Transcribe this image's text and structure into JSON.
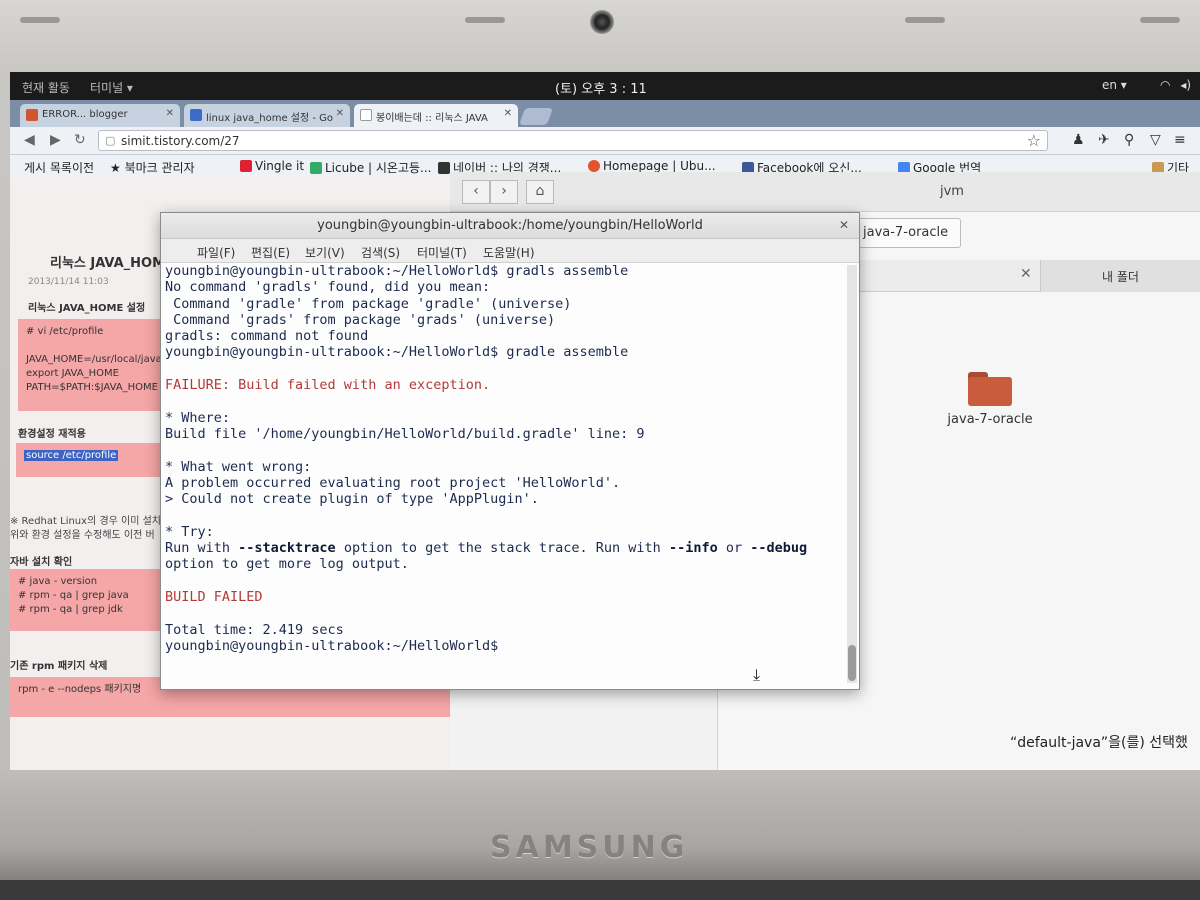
{
  "topbar": {
    "activities": "현재 활동",
    "app_menu": "터미널 ▾",
    "clock": "(토) 오후 3 : 11",
    "lang": "en ▾"
  },
  "browser": {
    "tabs": [
      {
        "label": "ERROR... blogger"
      },
      {
        "label": "linux java_home 설정 - Go"
      },
      {
        "label": "봉이배는데 :: 리눅스 JAVA"
      }
    ],
    "url": "simit.tistory.com/27",
    "bookmarks": [
      {
        "label": "게시 목록이전"
      },
      {
        "label": "북마크 관리자"
      },
      {
        "label": "Vingle it"
      },
      {
        "label": "Licube | 시온고등..."
      },
      {
        "label": "네이버 :: 나의 경쟁..."
      },
      {
        "label": "Homepage | Ubu..."
      },
      {
        "label": "Facebook에 오신..."
      },
      {
        "label": "Google 번역"
      },
      {
        "label": "기타"
      }
    ]
  },
  "blog": {
    "title": "리눅스 JAVA_HOME 설",
    "meta": "2013/11/14 11:03",
    "section1": "리눅스 JAVA_HOME 설정",
    "box1_lines": [
      "# vi /etc/profile",
      "",
      "JAVA_HOME=/usr/local/java",
      "export JAVA_HOME",
      "PATH=$PATH:$JAVA_HOME"
    ],
    "section2": "환경설정 재적용",
    "box2_line": "source /etc/profile",
    "note_line1": "※ Redhat Linux의 경우 이미 설치",
    "note_line2": "위와 환경 설정을 수정해도 이전 버",
    "section3": "자바 설치 확인",
    "box3_lines": [
      "# java - version",
      "# rpm - qa | grep java",
      "# rpm - qa | grep jdk"
    ],
    "section4": "기존 rpm 패키지 삭제",
    "box4_line": "rpm - e --nodeps 패키지명"
  },
  "file_manager": {
    "title": "jvm",
    "path_button": "java-7-oracle",
    "tab2_label": "내 폴더",
    "folder_label": "java-7-oracle",
    "status": "“default-java”을(를) 선택했"
  },
  "terminal": {
    "title": "youngbin@youngbin-ultrabook:/home/youngbin/HelloWorld",
    "menu": [
      "파일(F)",
      "편집(E)",
      "보기(V)",
      "검색(S)",
      "터미널(T)",
      "도움말(H)"
    ],
    "lines": [
      "youngbin@youngbin-ultrabook:~/HelloWorld$ gradls assemble",
      "No command 'gradls' found, did you mean:",
      " Command 'gradle' from package 'gradle' (universe)",
      " Command 'grads' from package 'grads' (universe)",
      "gradls: command not found",
      "youngbin@youngbin-ultrabook:~/HelloWorld$ gradle assemble",
      "",
      "FAILURE: Build failed with an exception.",
      "",
      "* Where:",
      "Build file '/home/youngbin/HelloWorld/build.gradle' line: 9",
      "",
      "* What went wrong:",
      "A problem occurred evaluating root project 'HelloWorld'.",
      "> Could not create plugin of type 'AppPlugin'.",
      "",
      "* Try:",
      "Run with --stacktrace option to get the stack trace. Run with --info or --debug",
      "option to get more log output.",
      "",
      "BUILD FAILED",
      "",
      "Total time: 2.419 secs",
      "youngbin@youngbin-ultrabook:~/HelloWorld$ "
    ]
  },
  "laptop": {
    "brand": "SAMSUNG"
  },
  "colors": {
    "terminal_text": "#1d2b4e",
    "error_red": "#b33a3a",
    "highlight_pink": "#f5a6a6",
    "folder_orange": "#c85c3c"
  }
}
